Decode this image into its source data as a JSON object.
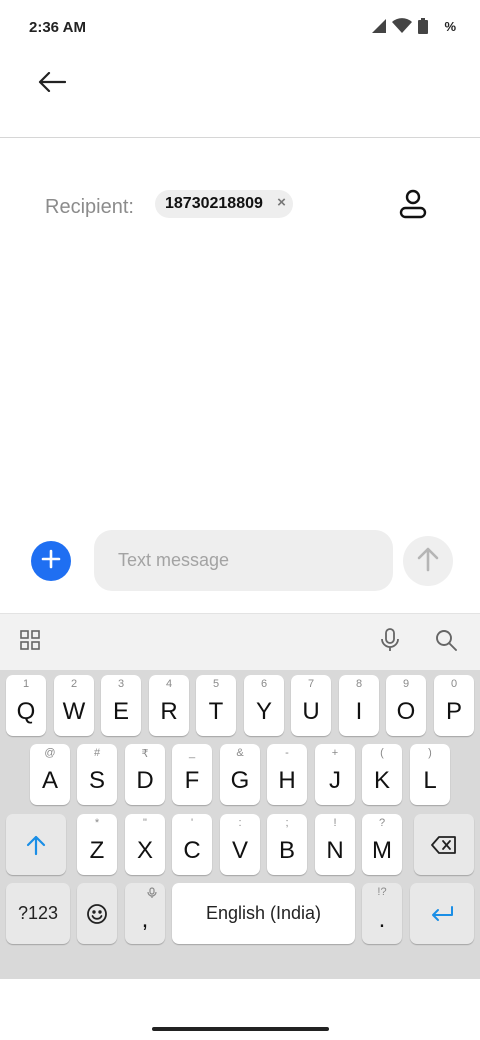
{
  "status_bar": {
    "time": "2:36 AM",
    "battery_text": "%",
    "icons": [
      "signal-icon",
      "wifi-icon",
      "battery-icon"
    ]
  },
  "app_bar": {
    "back_icon": "arrow-left-icon"
  },
  "recipient": {
    "label": "Recipient:",
    "chip_text": "18730218809",
    "chip_remove": "×",
    "contact_icon": "person-icon"
  },
  "compose": {
    "placeholder": "Text message",
    "value": "",
    "add_icon": "plus-icon",
    "send_icon": "arrow-up-icon",
    "accent": "#1f6ff2"
  },
  "keyboard_toolbar": {
    "left_icon": "grid-icon",
    "mic_icon": "mic-icon",
    "search_icon": "search-icon"
  },
  "keyboard": {
    "row1": [
      {
        "key": "Q",
        "hint": "1"
      },
      {
        "key": "W",
        "hint": "2"
      },
      {
        "key": "E",
        "hint": "3"
      },
      {
        "key": "R",
        "hint": "4"
      },
      {
        "key": "T",
        "hint": "5"
      },
      {
        "key": "Y",
        "hint": "6"
      },
      {
        "key": "U",
        "hint": "7"
      },
      {
        "key": "I",
        "hint": "8"
      },
      {
        "key": "O",
        "hint": "9"
      },
      {
        "key": "P",
        "hint": "0"
      }
    ],
    "row2": [
      {
        "key": "A",
        "hint": "@"
      },
      {
        "key": "S",
        "hint": "#"
      },
      {
        "key": "D",
        "hint": "₹"
      },
      {
        "key": "F",
        "hint": "_"
      },
      {
        "key": "G",
        "hint": "&"
      },
      {
        "key": "H",
        "hint": "-"
      },
      {
        "key": "J",
        "hint": "+"
      },
      {
        "key": "K",
        "hint": "("
      },
      {
        "key": "L",
        "hint": ")"
      }
    ],
    "row3": [
      {
        "key": "Z",
        "hint": "*"
      },
      {
        "key": "X",
        "hint": "\""
      },
      {
        "key": "C",
        "hint": "'"
      },
      {
        "key": "V",
        "hint": ":"
      },
      {
        "key": "B",
        "hint": ";"
      },
      {
        "key": "N",
        "hint": "!"
      },
      {
        "key": "M",
        "hint": "?"
      }
    ],
    "symbols_label": "?123",
    "comma_label": ",",
    "space_label": "English (India)",
    "period_label": ".",
    "period_hint": "!?",
    "accent": "#1a8ee6"
  }
}
